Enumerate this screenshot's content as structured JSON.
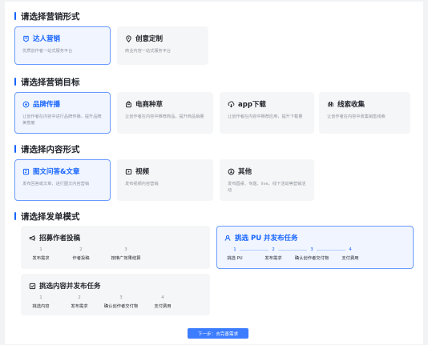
{
  "colors": {
    "accent": "#1664ff",
    "card_bg": "#f5f6f7",
    "selected_bg": "#f0f5ff"
  },
  "sections": {
    "form": {
      "title": "请选择营销形式",
      "options": [
        {
          "icon": "person-badge-icon",
          "label": "达人营销",
          "desc": "优质创作者一站式服务平台",
          "selected": true
        },
        {
          "icon": "location-pin-icon",
          "label": "创意定制",
          "desc": "商业内容一站式服务平台",
          "selected": false
        }
      ]
    },
    "goal": {
      "title": "请选择营销目标",
      "options": [
        {
          "icon": "brand-target-icon",
          "label": "品牌传播",
          "desc": "让创作者在内容中进行品牌传播，提升品牌美誉度",
          "selected": true
        },
        {
          "icon": "shop-bag-icon",
          "label": "电商种草",
          "desc": "让创作者在内容中推荐商品，提升商品销量",
          "selected": false
        },
        {
          "icon": "download-icon",
          "label": "app下载",
          "desc": "让创作者在内容中推荐应用，提升下载量",
          "selected": false
        },
        {
          "icon": "leads-icon",
          "label": "线索收集",
          "desc": "让创作者在内容中收集销售线索",
          "selected": false
        }
      ]
    },
    "content": {
      "title": "请选择内容形式",
      "options": [
        {
          "icon": "image-text-icon",
          "label": "图文问答&文章",
          "desc": "发布回答或文章，进行图文内容营销",
          "selected": true
        },
        {
          "icon": "video-play-icon",
          "label": "视频",
          "desc": "发布视频内容营销",
          "selected": false
        },
        {
          "icon": "more-circle-icon",
          "label": "其他",
          "desc": "发布圆桌、专题、live、线下活动等营销活动",
          "selected": false
        }
      ]
    },
    "mode": {
      "title": "请选择发单模式",
      "options": [
        {
          "icon": "recruit-megaphone-icon",
          "label": "招募作者投稿",
          "selected": false,
          "steps": [
            {
              "num": "1",
              "label": "发布需求"
            },
            {
              "num": "2",
              "label": "作者投稿"
            },
            {
              "num": "3",
              "label": "按推广效果结算"
            }
          ]
        },
        {
          "icon": "user-pick-icon",
          "label": "挑选 PU 并发布任务",
          "selected": true,
          "steps": [
            {
              "num": "1",
              "label": "挑选 PU"
            },
            {
              "num": "2",
              "label": "发布需求"
            },
            {
              "num": "3",
              "label": "确认创作者交付物"
            },
            {
              "num": "4",
              "label": "支付费用"
            }
          ]
        },
        {
          "icon": "content-pick-icon",
          "label": "挑选内容并发布任务",
          "selected": false,
          "steps": [
            {
              "num": "1",
              "label": "挑选内容"
            },
            {
              "num": "2",
              "label": "发布需求"
            },
            {
              "num": "3",
              "label": "确认创作者交付物"
            },
            {
              "num": "4",
              "label": "支付费用"
            }
          ]
        }
      ]
    }
  },
  "next_button": "下一步：去完善需求"
}
